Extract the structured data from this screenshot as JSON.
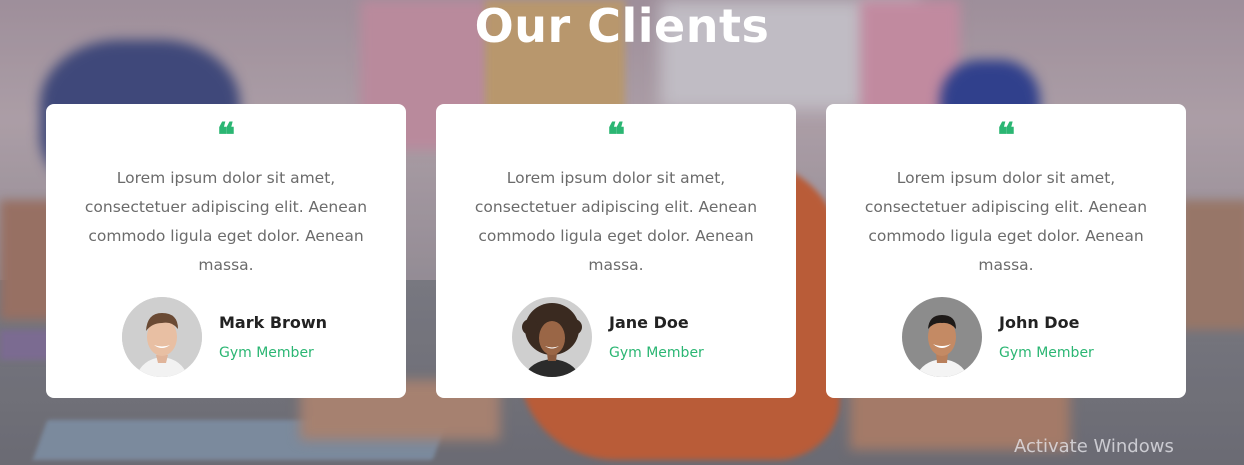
{
  "section": {
    "title": "Our Clients"
  },
  "colors": {
    "accent": "#2bb673",
    "card_bg": "#ffffff",
    "title": "#ffffff"
  },
  "testimonials": [
    {
      "quote_icon": "quote-icon",
      "text": "Lorem ipsum dolor sit amet, consectetuer adipiscing elit. Aenean commodo ligula eget dolor. Aenean massa.",
      "name": "Mark Brown",
      "role": "Gym Member",
      "avatar": "avatar-man-smiling"
    },
    {
      "quote_icon": "quote-icon",
      "text": "Lorem ipsum dolor sit amet, consectetuer adipiscing elit. Aenean commodo ligula eget dolor. Aenean massa.",
      "name": "Jane Doe",
      "role": "Gym Member",
      "avatar": "avatar-woman-curly-hair"
    },
    {
      "quote_icon": "quote-icon",
      "text": "Lorem ipsum dolor sit amet, consectetuer adipiscing elit. Aenean commodo ligula eget dolor. Aenean massa.",
      "name": "John Doe",
      "role": "Gym Member",
      "avatar": "avatar-man-short-hair"
    }
  ],
  "system": {
    "watermark": "Activate Windows"
  }
}
